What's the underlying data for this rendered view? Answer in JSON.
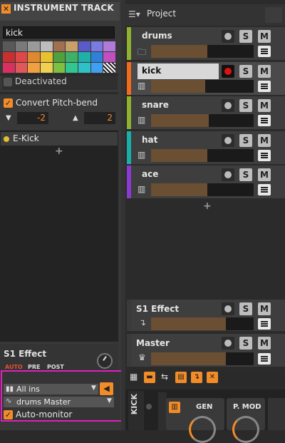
{
  "inspector": {
    "title": "INSTRUMENT TRACK",
    "name_value": "kick",
    "palette": [
      "#595959",
      "#7a7a7a",
      "#9a9a9a",
      "#bdbdbd",
      "#a07050",
      "#c8a068",
      "#5a5ac8",
      "#7a7ae0",
      "#b07ad8",
      "#c83030",
      "#e04848",
      "#e08830",
      "#e8c030",
      "#50a040",
      "#40b068",
      "#20b0a8",
      "#3080d8",
      "#c050c0",
      "#d83060",
      "#e05858",
      "#f0a040",
      "#f0d050",
      "#80c040",
      "#30c890",
      "#30c0c8",
      "#40a0f0",
      "#ffffff"
    ],
    "deactivated_label": "Deactivated",
    "convert_pitch_bend_label": "Convert Pitch-bend",
    "pitch_down_value": "-2",
    "pitch_up_value": "2",
    "device_name": "E-Kick",
    "send_name": "S1 Effect",
    "send_modes": [
      "AUTO",
      "PRE",
      "POST"
    ],
    "input_value": "All ins",
    "output_value": "drums Master",
    "auto_monitor_label": "Auto-monitor"
  },
  "project": {
    "title": "Project",
    "tracks": [
      {
        "name": "drums",
        "color": "#90b030",
        "icon": "folder-icon",
        "fill": 0.55
      },
      {
        "name": "kick",
        "color": "#f26b1d",
        "icon": "piano-icon",
        "fill": 0.53,
        "selected": true,
        "armed": true
      },
      {
        "name": "snare",
        "color": "#90b030",
        "icon": "piano-icon",
        "fill": 0.56
      },
      {
        "name": "hat",
        "color": "#18b0a8",
        "icon": "piano-icon",
        "fill": 0.55
      },
      {
        "name": "ace",
        "color": "#8a3ad0",
        "icon": "piano-icon",
        "fill": 0.55
      }
    ],
    "effect_track": {
      "name": "S1 Effect",
      "fill": 0.73
    },
    "master_track": {
      "name": "Master",
      "fill": 0.73
    },
    "solo_label": "S",
    "mute_label": "M",
    "device_title": "KICK",
    "knobs": [
      "GEN",
      "P. MOD"
    ]
  }
}
